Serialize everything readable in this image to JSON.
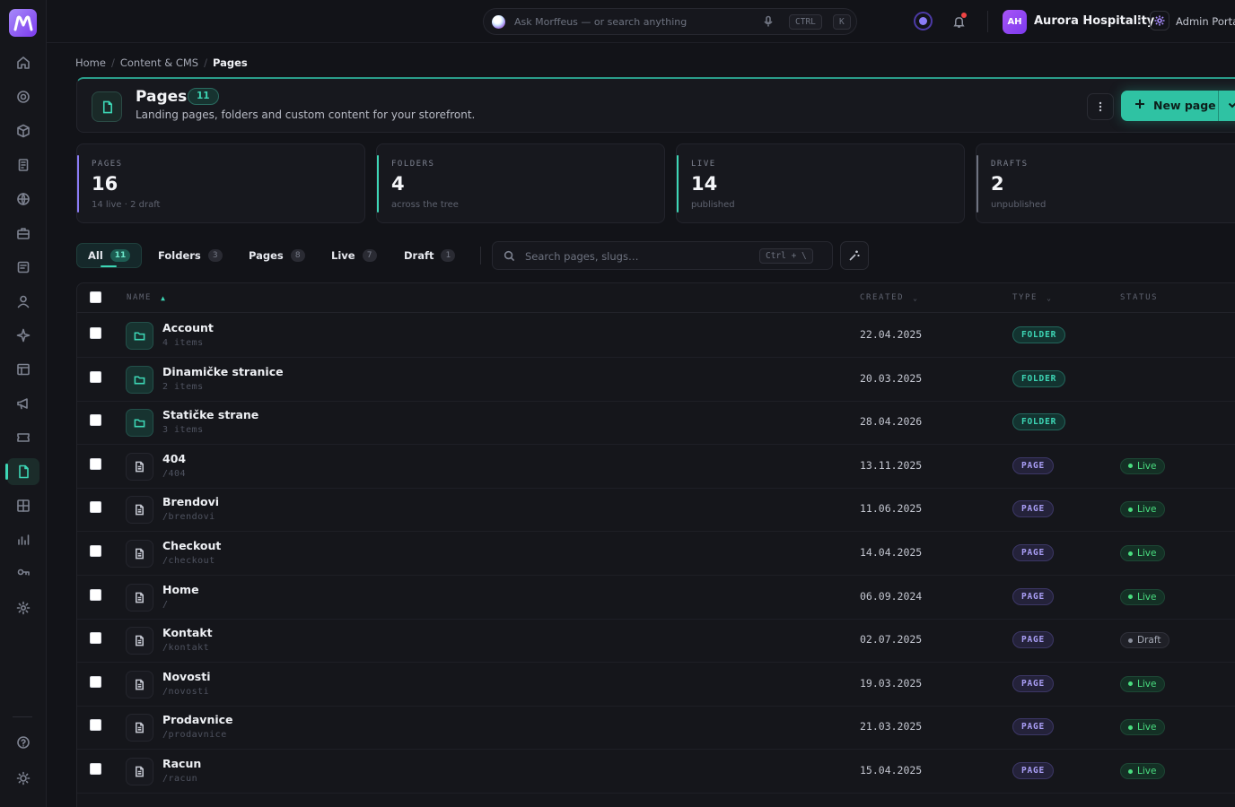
{
  "topbar": {
    "search_placeholder": "Ask Morffeus — or search anything",
    "kbd_ctrl": "CTRL",
    "kbd_k": "K",
    "avatar_initials": "AH",
    "org_name": "Aurora Hospitality",
    "portal_name": "Admin Portal"
  },
  "breadcrumb": [
    "Home",
    "Content & CMS",
    "Pages"
  ],
  "header": {
    "title": "Pages",
    "count": "11",
    "subtitle": "Landing pages, folders and custom content for your storefront.",
    "new_button": "New page"
  },
  "stats": [
    {
      "label": "PAGES",
      "value": "16",
      "sub": "14 live · 2 draft",
      "color": "#8b7cf6"
    },
    {
      "label": "FOLDERS",
      "value": "4",
      "sub": "across the tree",
      "color": "#3dd6b5"
    },
    {
      "label": "LIVE",
      "value": "14",
      "sub": "published",
      "color": "#3dd6b5"
    },
    {
      "label": "DRAFTS",
      "value": "2",
      "sub": "unpublished",
      "color": "#6e7380"
    }
  ],
  "filters": [
    {
      "label": "All",
      "count": "11"
    },
    {
      "label": "Folders",
      "count": "3"
    },
    {
      "label": "Pages",
      "count": "8"
    },
    {
      "label": "Live",
      "count": "7"
    },
    {
      "label": "Draft",
      "count": "1"
    }
  ],
  "search": {
    "placeholder": "Search pages, slugs…",
    "hint": "Ctrl + \\"
  },
  "table": {
    "columns": {
      "name": "NAME",
      "created": "CREATED",
      "type": "TYPE",
      "status": "STATUS"
    },
    "rows": [
      {
        "name": "Account",
        "sub": "4 items",
        "date": "22.04.2025",
        "type": "FOLDER",
        "kind": "folder",
        "status": ""
      },
      {
        "name": "Dinamičke stranice",
        "sub": "2 items",
        "date": "20.03.2025",
        "type": "FOLDER",
        "kind": "folder",
        "status": ""
      },
      {
        "name": "Statičke strane",
        "sub": "3 items",
        "date": "28.04.2026",
        "type": "FOLDER",
        "kind": "folder",
        "status": ""
      },
      {
        "name": "404",
        "sub": "/404",
        "date": "13.11.2025",
        "type": "PAGE",
        "kind": "page",
        "status": "Live"
      },
      {
        "name": "Brendovi",
        "sub": "/brendovi",
        "date": "11.06.2025",
        "type": "PAGE",
        "kind": "page",
        "status": "Live"
      },
      {
        "name": "Checkout",
        "sub": "/checkout",
        "date": "14.04.2025",
        "type": "PAGE",
        "kind": "page",
        "status": "Live"
      },
      {
        "name": "Home",
        "sub": "/",
        "date": "06.09.2024",
        "type": "PAGE",
        "kind": "page",
        "status": "Live"
      },
      {
        "name": "Kontakt",
        "sub": "/kontakt",
        "date": "02.07.2025",
        "type": "PAGE",
        "kind": "page",
        "status": "Draft"
      },
      {
        "name": "Novosti",
        "sub": "/novosti",
        "date": "19.03.2025",
        "type": "PAGE",
        "kind": "page",
        "status": "Live"
      },
      {
        "name": "Prodavnice",
        "sub": "/prodavnice",
        "date": "21.03.2025",
        "type": "PAGE",
        "kind": "page",
        "status": "Live"
      },
      {
        "name": "Racun",
        "sub": "/racun",
        "date": "15.04.2025",
        "type": "PAGE",
        "kind": "page",
        "status": "Live"
      }
    ]
  },
  "sidebar_icons": [
    "home-icon",
    "target-icon",
    "box-icon",
    "document-icon",
    "globe-icon",
    "briefcase-icon",
    "list-icon",
    "user-icon",
    "sparkle-icon",
    "layout-icon",
    "megaphone-icon",
    "ticket-icon",
    "pages-icon",
    "grid-icon",
    "chart-icon",
    "key-icon",
    "settings-icon"
  ],
  "colors": {
    "accent": "#3dd6b5",
    "brand": "#7c3aed",
    "live": "#4ade80"
  }
}
